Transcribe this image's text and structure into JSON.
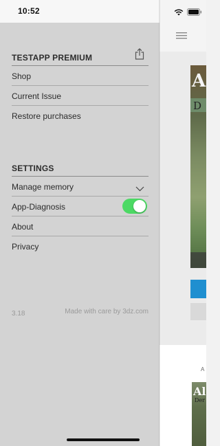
{
  "status_bar": {
    "time": "10:52"
  },
  "drawer": {
    "premium_section": {
      "title": "TESTAPP PREMIUM",
      "items": [
        {
          "label": "Shop"
        },
        {
          "label": "Current Issue"
        },
        {
          "label": "Restore purchases"
        }
      ]
    },
    "settings_section": {
      "title": "SETTINGS",
      "items": [
        {
          "label": "Manage memory"
        },
        {
          "label": "App-Diagnosis",
          "toggle_on": true
        },
        {
          "label": "About"
        },
        {
          "label": "Privacy"
        }
      ]
    },
    "version": "3.18",
    "credit": "Made with care by 3dz.com"
  },
  "main_behind": {
    "cover_title": "A",
    "cover_subtitle": "D",
    "small_text": "A",
    "cover2_title": "Al",
    "cover2_subtitle": "Der"
  },
  "colors": {
    "drawer_bg": "#d3d3d3",
    "toggle_on": "#4cd964",
    "accent_blue": "#1f8fd0"
  },
  "icons": [
    "wifi-icon",
    "battery-icon",
    "share-icon",
    "chevron-down-icon",
    "hamburger-menu-icon"
  ]
}
